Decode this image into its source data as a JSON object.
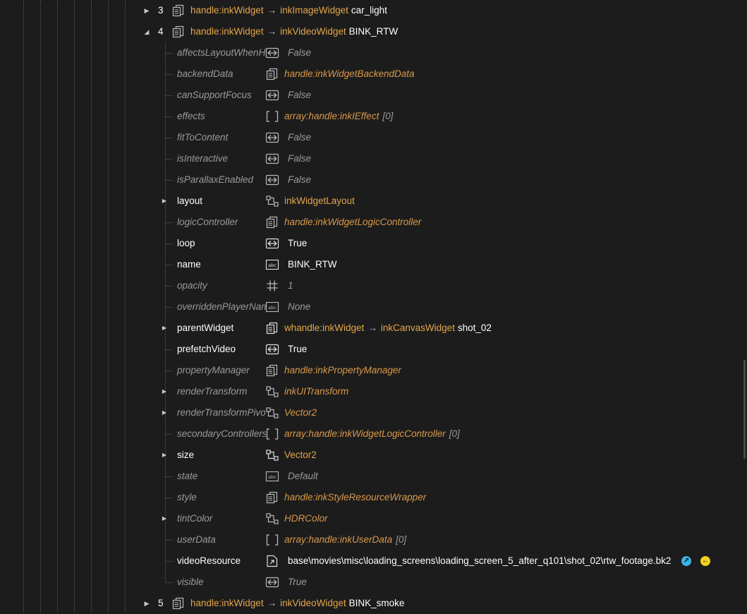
{
  "nodes": [
    {
      "index": "3",
      "type": "handle:inkWidget",
      "arrow": "→",
      "class": "inkImageWidget",
      "name": "car_light",
      "expanded": false
    },
    {
      "index": "4",
      "type": "handle:inkWidget",
      "arrow": "→",
      "class": "inkVideoWidget",
      "name": "BINK_RTW",
      "expanded": true
    },
    {
      "index": "5",
      "type": "handle:inkWidget",
      "arrow": "→",
      "class": "inkVideoWidget",
      "name": "BINK_smoke",
      "expanded": false
    }
  ],
  "properties": [
    {
      "name": "affectsLayoutWhenHidden",
      "value": "False",
      "icon": "bool-icon"
    },
    {
      "name": "backendData",
      "value": "handle:inkWidgetBackendData",
      "icon": "handle-icon"
    },
    {
      "name": "canSupportFocus",
      "value": "False",
      "icon": "bool-icon"
    },
    {
      "name": "effects",
      "value": "array:handle:inkIEffect",
      "count": "[0]",
      "icon": "array-icon"
    },
    {
      "name": "fitToContent",
      "value": "False",
      "icon": "bool-icon"
    },
    {
      "name": "isInteractive",
      "value": "False",
      "icon": "bool-icon"
    },
    {
      "name": "isParallaxEnabled",
      "value": "False",
      "icon": "bool-icon"
    },
    {
      "name": "layout",
      "value": "inkWidgetLayout",
      "icon": "struct-icon"
    },
    {
      "name": "logicController",
      "value": "handle:inkWidgetLogicController",
      "icon": "handle-icon"
    },
    {
      "name": "loop",
      "value": "True",
      "icon": "bool-icon"
    },
    {
      "name": "name",
      "value": "BINK_RTW",
      "icon": "string-icon"
    },
    {
      "name": "opacity",
      "value": "1",
      "icon": "number-icon"
    },
    {
      "name": "overriddenPlayerName",
      "value": "None",
      "icon": "string-icon"
    },
    {
      "name": "parentWidget",
      "value": "whandle:inkWidget",
      "arrow": "→",
      "class": "inkCanvasWidget",
      "inst": "shot_02",
      "icon": "handle-icon"
    },
    {
      "name": "prefetchVideo",
      "value": "True",
      "icon": "bool-icon"
    },
    {
      "name": "propertyManager",
      "value": "handle:inkPropertyManager",
      "icon": "handle-icon"
    },
    {
      "name": "renderTransform",
      "value": "inkUITransform",
      "icon": "struct-icon"
    },
    {
      "name": "renderTransformPivot",
      "value": "Vector2",
      "icon": "struct-icon"
    },
    {
      "name": "secondaryControllers",
      "value": "array:handle:inkWidgetLogicController",
      "count": "[0]",
      "icon": "array-icon"
    },
    {
      "name": "size",
      "value": "Vector2",
      "icon": "struct-icon"
    },
    {
      "name": "state",
      "value": "Default",
      "icon": "string-icon"
    },
    {
      "name": "style",
      "value": "handle:inkStyleResourceWrapper",
      "icon": "handle-icon"
    },
    {
      "name": "tintColor",
      "value": "HDRColor",
      "icon": "struct-icon"
    },
    {
      "name": "userData",
      "value": "array:handle:inkUserData",
      "count": "[0]",
      "icon": "array-icon"
    },
    {
      "name": "videoResource",
      "value": "base\\movies\\misc\\loading_screens\\loading_screen_5_after_q101\\shot_02\\rtw_footage.bk2",
      "icon": "resource-icon"
    },
    {
      "name": "visible",
      "value": "True",
      "icon": "bool-icon"
    }
  ],
  "colors": {
    "background": "#1c1c1c",
    "type_link": "#e4a64b",
    "dim_text": "#9a9a9a",
    "text": "#ffffff",
    "open_button": "#3ab4e8",
    "back_button": "#f2d11b"
  }
}
